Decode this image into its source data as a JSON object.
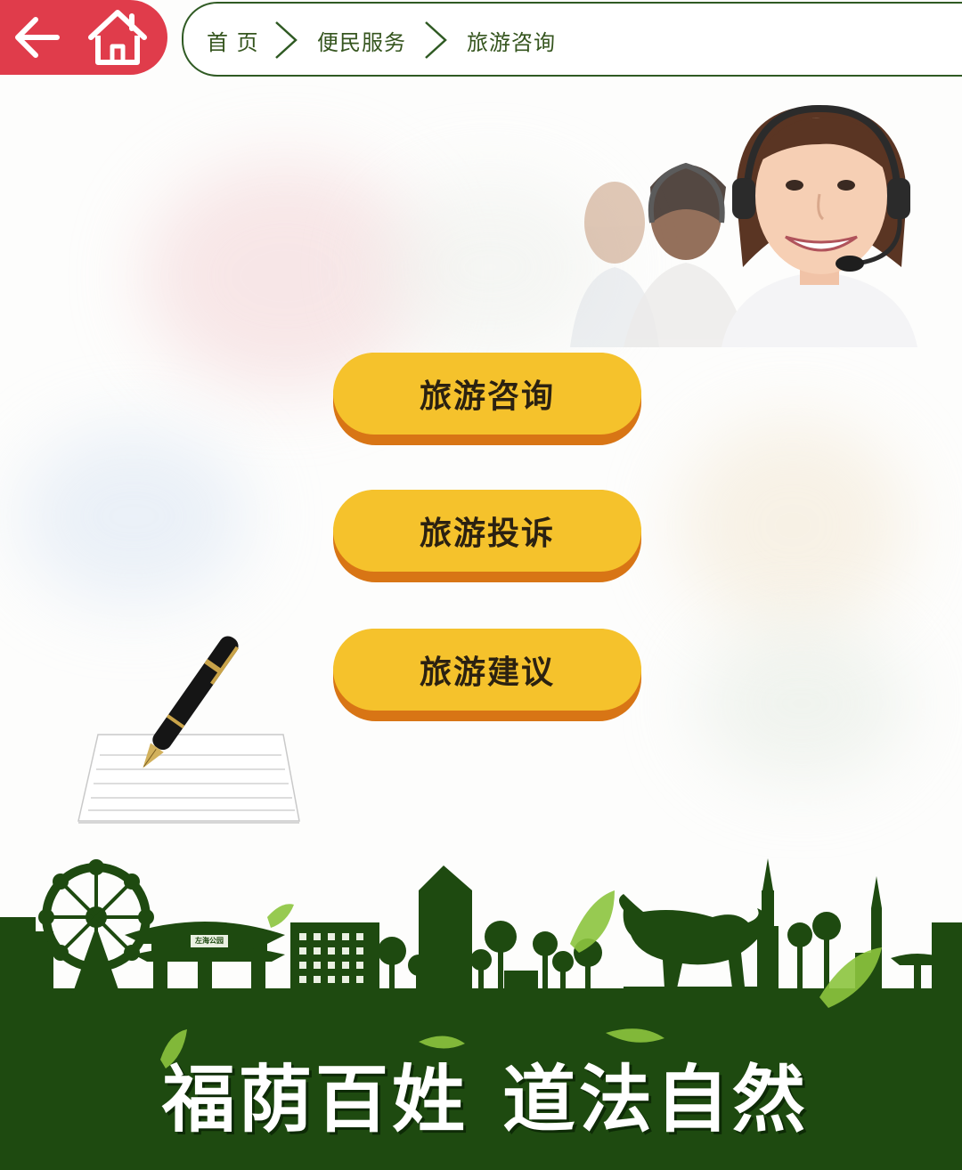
{
  "header": {
    "back_icon": "arrow-left-icon",
    "home_icon": "home-icon",
    "accent_color": "#e03c4b",
    "breadcrumb": [
      {
        "label": "首 页"
      },
      {
        "label": "便民服务"
      },
      {
        "label": "旅游咨询"
      }
    ],
    "separator_icon": "chevron-right-icon"
  },
  "menu": {
    "button_color": "#f5c22c",
    "button_shadow_color": "#d87515",
    "items": [
      {
        "label": "旅游咨询"
      },
      {
        "label": "旅游投诉"
      },
      {
        "label": "旅游建议"
      }
    ]
  },
  "footer": {
    "slogan_left": "福荫百姓",
    "slogan_right": "道法自然",
    "sign_text": "左海公园",
    "color": "#1e4a10"
  }
}
